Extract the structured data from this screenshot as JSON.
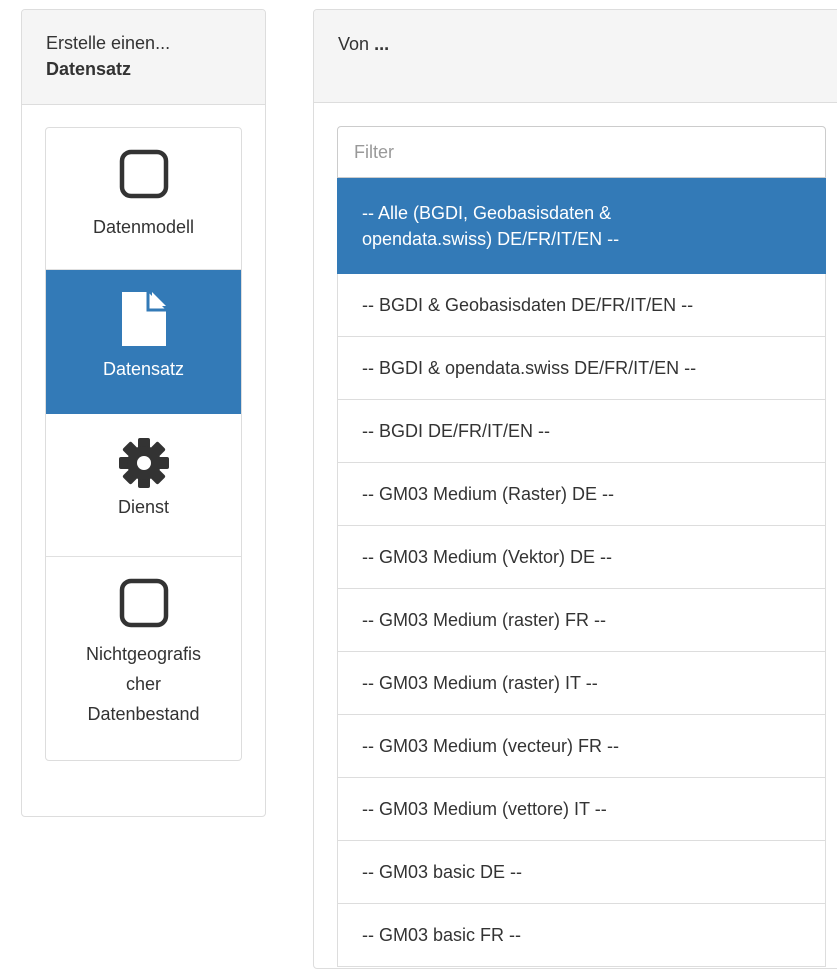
{
  "left_panel": {
    "heading_line1": "Erstelle einen...",
    "heading_line2": "Datensatz",
    "types": [
      {
        "label": "Datenmodell",
        "icon": "square-outline-icon",
        "active": false
      },
      {
        "label": "Datensatz",
        "icon": "file-icon",
        "active": true
      },
      {
        "label": "Dienst",
        "icon": "gear-icon",
        "active": false
      },
      {
        "label_lines": [
          "Nichtgeografis",
          "cher",
          "Datenbestand"
        ],
        "icon": "square-outline-icon",
        "active": false
      }
    ]
  },
  "right_panel": {
    "heading_prefix": "Von",
    "heading_dots": "...",
    "filter_placeholder": "Filter",
    "filter_value": "",
    "options": [
      "-- Alle (BGDI, Geobasisdaten & opendata.swiss) DE/FR/IT/EN --",
      "-- BGDI & Geobasisdaten DE/FR/IT/EN --",
      "-- BGDI & opendata.swiss DE/FR/IT/EN --",
      "-- BGDI DE/FR/IT/EN --",
      "-- GM03 Medium (Raster) DE --",
      "-- GM03 Medium (Vektor) DE --",
      "-- GM03 Medium (raster) FR --",
      "-- GM03 Medium (raster) IT --",
      "-- GM03 Medium (vecteur) FR --",
      "-- GM03 Medium (vettore) IT --",
      "-- GM03 basic DE --",
      "-- GM03 basic FR --"
    ],
    "selected_index": 0
  },
  "colors": {
    "accent": "#337ab7",
    "panel_heading_bg": "#f5f5f5",
    "border": "#dddddd",
    "text": "#333333"
  }
}
